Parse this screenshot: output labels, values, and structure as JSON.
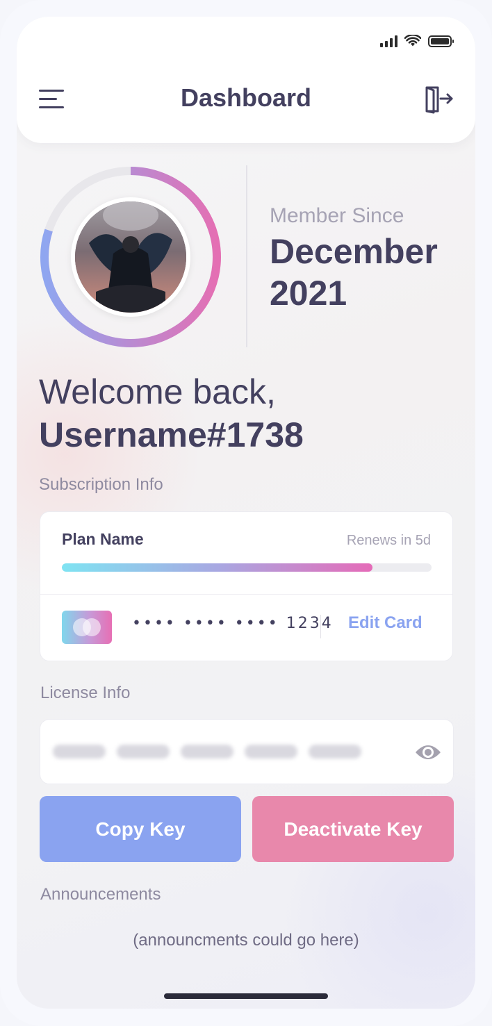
{
  "status_bar": {
    "icons": [
      "cellular-signal-icon",
      "wifi-icon",
      "battery-icon"
    ]
  },
  "header": {
    "title": "Dashboard",
    "left_icon": "menu-icon",
    "right_icon": "logout-icon"
  },
  "profile": {
    "avatar_alt": "user-avatar",
    "ring_progress_percent": 80,
    "ring_colors": [
      "#8fa6f0",
      "#e46fb3"
    ],
    "member_since_label": "Member Since",
    "member_since_date": "December 2021"
  },
  "greeting": {
    "welcome": "Welcome back,",
    "username": "Username#1738"
  },
  "subscription": {
    "section_label": "Subscription Info",
    "plan_name": "Plan Name",
    "renews_text": "Renews in 5d",
    "progress_percent": 84,
    "card_number": "•••• •••• •••• 1234",
    "edit_card_label": "Edit Card"
  },
  "license": {
    "section_label": "License Info",
    "key_hidden": true,
    "eye_icon": "eye-icon"
  },
  "actions": {
    "copy_key_label": "Copy Key",
    "deactivate_key_label": "Deactivate Key",
    "copy_color": "#8aa3f0",
    "deactivate_color": "#e888ab"
  },
  "announcements": {
    "section_label": "Announcements",
    "placeholder_text": "(announcments could go here)"
  }
}
